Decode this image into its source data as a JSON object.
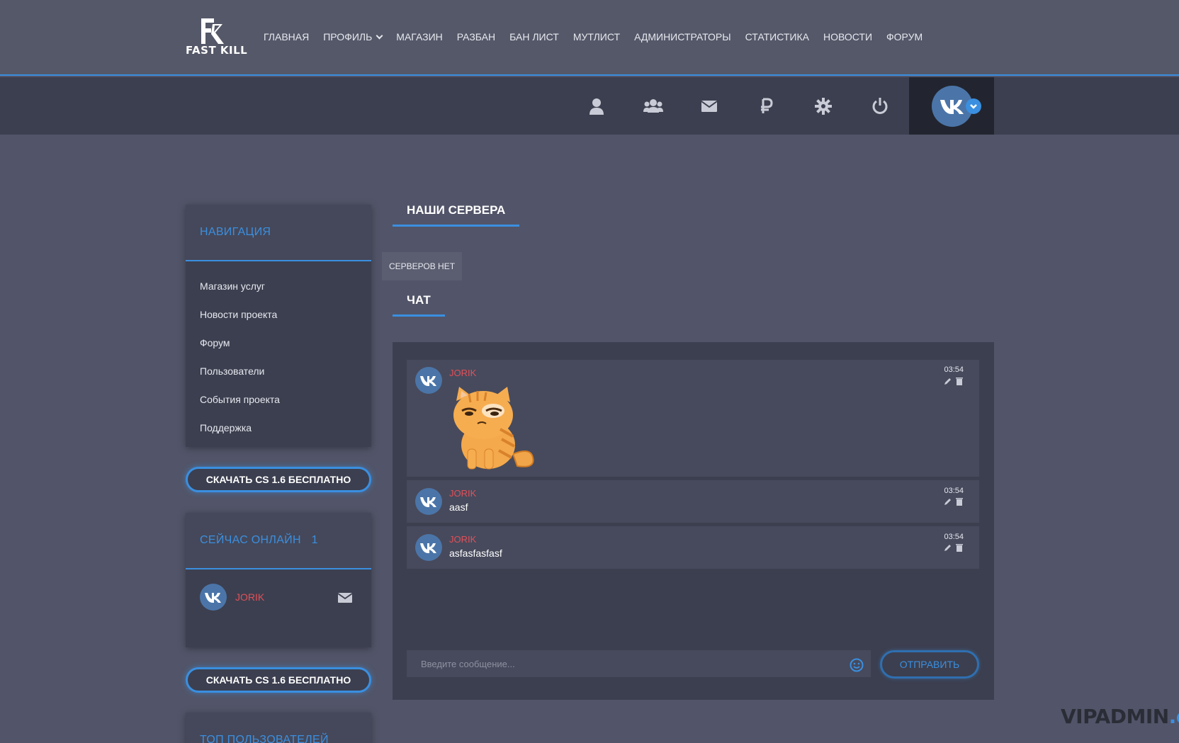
{
  "brand": {
    "name": "FAST KILL"
  },
  "menu": [
    {
      "label": "ГЛАВНАЯ"
    },
    {
      "label": "ПРОФИЛЬ",
      "dropdown": true
    },
    {
      "label": "МАГАЗИН"
    },
    {
      "label": "РАЗБАН"
    },
    {
      "label": "БАН ЛИСТ"
    },
    {
      "label": "МУТЛИСТ"
    },
    {
      "label": "АДМИНИСТРАТОРЫ"
    },
    {
      "label": "СТАТИСТИКА"
    },
    {
      "label": "НОВОСТИ"
    },
    {
      "label": "ФОРУМ"
    }
  ],
  "toolbar": {
    "icons": [
      "user-icon",
      "users-icon",
      "envelope-icon",
      "ruble-icon",
      "gear-icon",
      "power-icon"
    ],
    "account": {
      "icon": "vk-avatar",
      "badge_icon": "chevron-down-icon"
    }
  },
  "sidebar": {
    "navigation": {
      "title": "НАВИГАЦИЯ",
      "items": [
        {
          "label": "Магазин услуг"
        },
        {
          "label": "Новости проекта"
        },
        {
          "label": "Форум"
        },
        {
          "label": "Пользователи"
        },
        {
          "label": "События проекта"
        },
        {
          "label": "Поддержка"
        }
      ]
    },
    "download_label": "СКАЧАТЬ CS 1.6 БЕСПЛАТНО",
    "online": {
      "title": "СЕЙЧАС ОНЛАЙН",
      "count": "1",
      "users": [
        {
          "name": "JORIK"
        }
      ]
    },
    "top_users_title": "ТОП ПОЛЬЗОВАТЕЛЕЙ"
  },
  "main": {
    "servers": {
      "title": "НАШИ СЕРВЕРА",
      "empty_text": "СЕРВЕРОВ НЕТ"
    },
    "chat": {
      "title": "ЧАТ",
      "messages": [
        {
          "author": "JORIK",
          "time": "03:54",
          "text": "",
          "sticker": "grumpy-cat-sticker"
        },
        {
          "author": "JORIK",
          "time": "03:54",
          "text": "aasf"
        },
        {
          "author": "JORIK",
          "time": "03:54",
          "text": "asfasfasfasf"
        }
      ],
      "input_placeholder": "Введите сообщение...",
      "send_label": "ОТПРАВИТЬ"
    }
  },
  "watermark": {
    "main": "VIPADMIN",
    "suffix": ".club"
  },
  "colors": {
    "accent": "#3a8fe0",
    "username": "#e0505a",
    "background": "#525569",
    "panel": "#3c3f4f"
  }
}
